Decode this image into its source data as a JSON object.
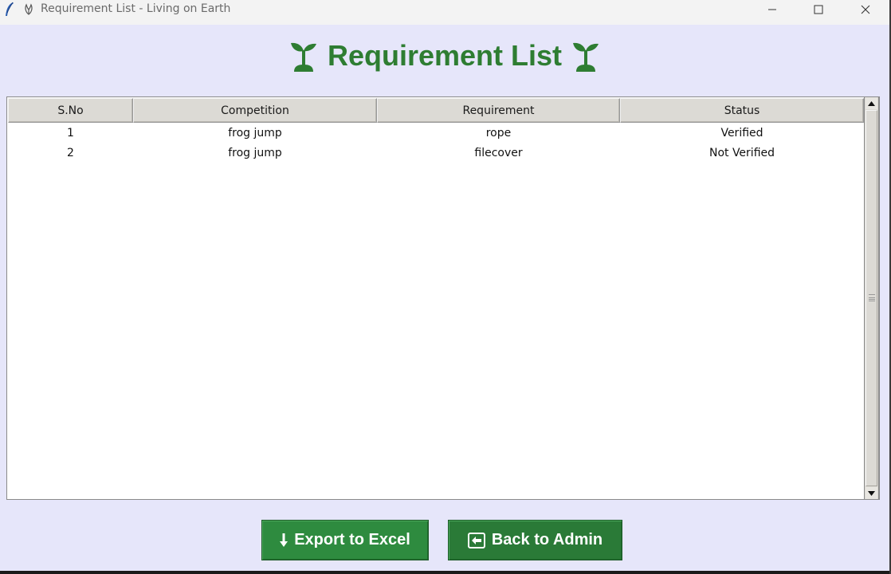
{
  "window": {
    "title": "Requirement List - Living on Earth",
    "controls": {
      "minimize": "minimize-icon",
      "maximize": "maximize-icon",
      "close": "close-icon"
    }
  },
  "heading": {
    "text": "Requirement List",
    "icon": "sprout-icon",
    "color": "#2e7d32"
  },
  "table": {
    "columns": [
      "S.No",
      "Competition",
      "Requirement",
      "Status"
    ],
    "rows": [
      [
        "1",
        "frog jump",
        "rope",
        "Verified"
      ],
      [
        "2",
        "frog jump",
        "filecover",
        "Not Verified"
      ]
    ]
  },
  "buttons": {
    "export": {
      "label": "Export to Excel",
      "icon": "download-arrow-icon"
    },
    "back": {
      "label": "Back to Admin",
      "icon": "back-arrow-icon"
    },
    "color": "#2e8b3f"
  },
  "colors": {
    "background": "#e6e6fa",
    "accent": "#2e7d32"
  }
}
